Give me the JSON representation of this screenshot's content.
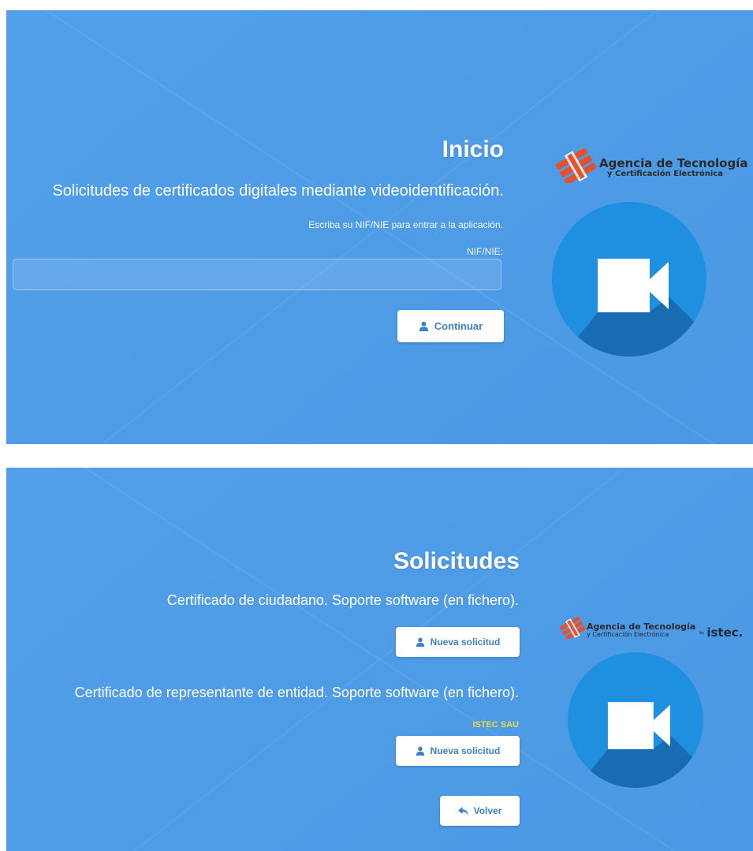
{
  "inicio": {
    "title": "Inicio",
    "subtitle": "Solicitudes de certificados digitales mediante videoidentificación.",
    "instruction": "Escriba su NIF/NIE para entrar a la aplicación.",
    "field_label": "NIF/NIE:",
    "field_value": "",
    "continue_label": "Continuar"
  },
  "solicitudes": {
    "title": "Solicitudes",
    "cert1_text": "Certificado de ciudadano. Soporte software (en fichero).",
    "cert1_button": "Nueva solicitud",
    "cert2_text": "Certificado de representante de entidad. Soporte software (en fichero).",
    "entity_name": "ISTEC SAU",
    "cert2_button": "Nueva solicitud",
    "back_button": "Volver"
  },
  "logo": {
    "main": "Agencia de Tecnología",
    "sub": "y Certificación Electrónica",
    "partner_prefix": "by",
    "partner": "istec."
  },
  "icons": {
    "user": "user-icon",
    "back": "reply-arrow-icon",
    "camera": "video-camera-icon",
    "logo": "accv-logo-icon"
  },
  "colors": {
    "background": "#4c9be8",
    "circle": "#1f8fe0",
    "button_text": "#3d82c9",
    "logo_red": "#e5512a",
    "highlight_yellow": "#f2d64b"
  }
}
